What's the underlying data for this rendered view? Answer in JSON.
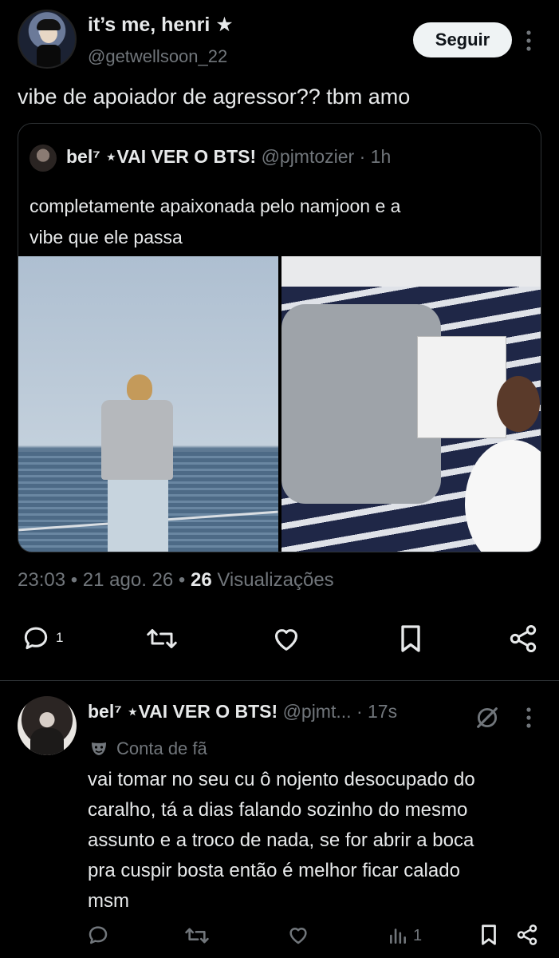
{
  "main_tweet": {
    "author_name": "it’s me, henri",
    "author_star": "★",
    "author_handle": "@getwellsoon_22",
    "follow_label": "Seguir",
    "text": "vibe de apoiador de agressor?? tbm amo",
    "quote": {
      "author_name": "bel⁷",
      "author_name_rest": "⋆VAI VER O BTS!",
      "author_handle": "@pjmtozier",
      "dot": "·",
      "time": "1h",
      "text_line1": "completamente apaixonada pelo namjoon e a",
      "text_line2": "vibe que ele passa"
    },
    "timestamp": "23:03 • 21 ago. 26 •",
    "views_count": "26",
    "views_label": "Visualizações",
    "reply_count": "1"
  },
  "reply": {
    "author_name": "bel⁷",
    "author_name_rest": "⋆VAI VER O BTS!",
    "author_handle": "@pjmt...",
    "dot": "·",
    "time": "17s",
    "badge_label": "Conta de fã",
    "text_lines": [
      "vai tomar no seu cu ô nojento desocupado do",
      "caralho, tá a dias falando sozinho do mesmo",
      "assunto e a troco de nada, se for abrir a boca",
      "pra cuspir bosta então é melhor ficar calado",
      "msm"
    ],
    "views_count": "1"
  },
  "colors": {
    "background": "#000000",
    "text": "#e7e9ea",
    "muted": "#71767b",
    "border": "#2f3336"
  }
}
